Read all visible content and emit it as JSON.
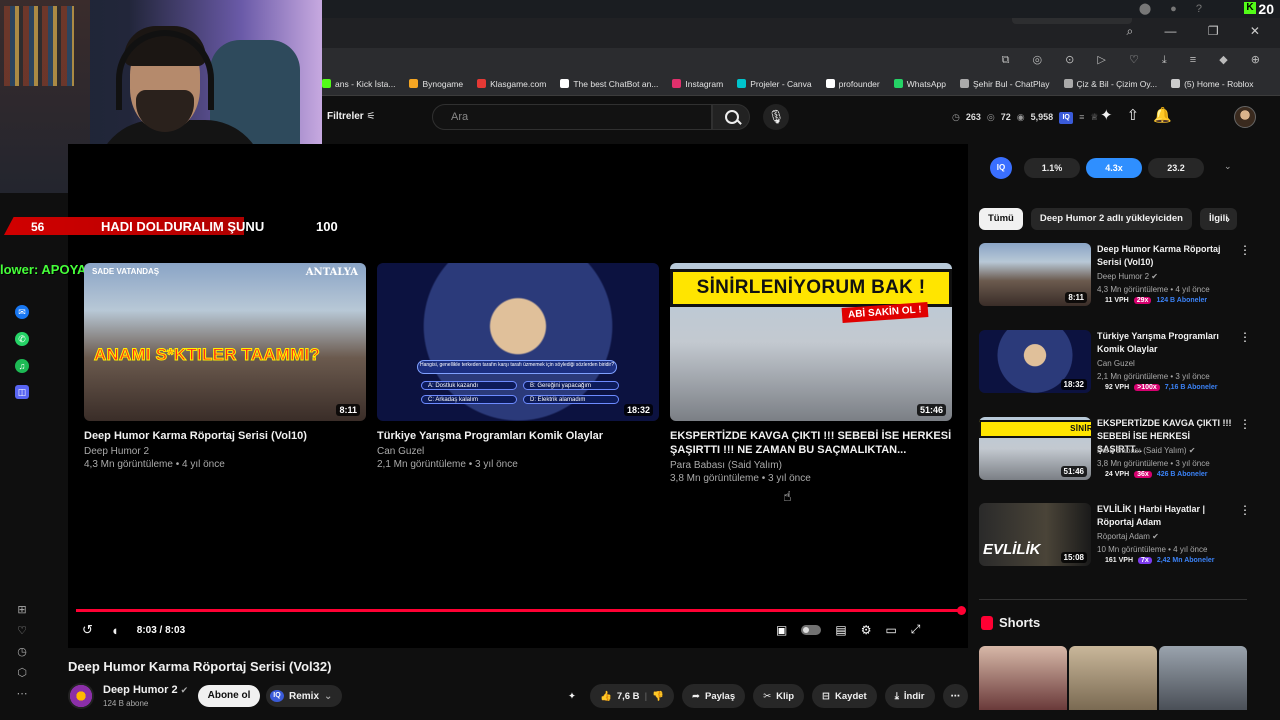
{
  "system": {
    "counter": "20",
    "kick_letter": "K"
  },
  "bookmarks": [
    {
      "label": "ans - Kick İsta...",
      "color": "#53fc18"
    },
    {
      "label": "Bynogame",
      "color": "#f5a623"
    },
    {
      "label": "Klasgame.com",
      "color": "#e53935"
    },
    {
      "label": "The best ChatBot an...",
      "color": "#ffffff"
    },
    {
      "label": "Instagram",
      "color": "#e1306c"
    },
    {
      "label": "Projeler - Canva",
      "color": "#00c4cc"
    },
    {
      "label": "profounder",
      "color": "#ffffff"
    },
    {
      "label": "WhatsApp",
      "color": "#25d366"
    },
    {
      "label": "Şehir Bul - ChatPlay",
      "color": "#aaaaaa"
    },
    {
      "label": "Çiz & Bil - Çizim Oy...",
      "color": "#aaaaaa"
    },
    {
      "label": "(5) Home - Roblox",
      "color": "#cccccc"
    }
  ],
  "header": {
    "filters_label": "Filtreler",
    "search_placeholder": "Ara",
    "stats": [
      "263",
      "72",
      "5,958"
    ]
  },
  "overlay": {
    "progress_left": "56",
    "progress_label": "HADI DOLDURALIM ŞUNU",
    "progress_right": "100",
    "follower_text": "lower: APOYASIRTAKIOYNATIPSKEN"
  },
  "end_cards": [
    {
      "title": "Deep Humor Karma Röportaj Serisi (Vol10)",
      "channel": "Deep Humor 2",
      "meta": "4,3 Mn görüntüleme • 4 yıl önce",
      "duration": "8:11",
      "thumb_text": "ANAMI S*KTILER TAAMMI?",
      "thumb_corner": "ANTALYA",
      "thumb_corner_left": "SADE VATANDAŞ"
    },
    {
      "title": "Türkiye Yarışma Programları Komik Olaylar",
      "channel": "Can Guzel",
      "meta": "2,1 Mn görüntüleme • 3 yıl önce",
      "duration": "18:32",
      "thumb_question": "Hangisi, genellikle terkeden tarafın karşı tarafı üzmemek için söylediği sözlerden biridir?",
      "answers": [
        "A: Dostluk kazandı",
        "B: Gereğini yapacağım",
        "C: Arkadaş kalalım",
        "D: Elektrik alamadım"
      ]
    },
    {
      "title": "EKSPERTİZDE KAVGA ÇIKTI !!! SEBEBİ İSE HERKESİ ŞAŞIRTTI !!! NE ZAMAN BU SAÇMALIKTAN...",
      "channel": "Para Babası (Said Yalım)",
      "meta": "3,8 Mn görüntüleme • 3 yıl önce",
      "duration": "51:46",
      "thumb_banner": "SİNİRLENİYORUM BAK !",
      "thumb_sub": "ABİ SAKİN OL !"
    }
  ],
  "player": {
    "time": "8:03 / 8:03",
    "progress_fraction": 1.0
  },
  "video": {
    "title": "Deep Humor Karma Röportaj Serisi (Vol32)",
    "channel": "Deep Humor 2",
    "subs": "124 B abone",
    "subscribe_label": "Abone ol",
    "remix_label": "Remix",
    "likes": "7,6 B",
    "share_label": "Paylaş",
    "clip_label": "Klip",
    "save_label": "Kaydet",
    "download_label": "İndir"
  },
  "iq_panel": {
    "chips": [
      "1.1%",
      "4.3x",
      "23.2"
    ],
    "active_index": 1,
    "logo": "IQ"
  },
  "chips": [
    "Tümü",
    "Deep Humor 2 adlı yükleyiciden",
    "İlgili"
  ],
  "related": [
    {
      "title": "Deep Humor Karma Röportaj Serisi (Vol10)",
      "channel": "Deep Humor 2",
      "meta": "4,3 Mn görüntüleme • 4 yıl önce",
      "duration": "8:11",
      "vph": "11 VPH",
      "mult": "29x",
      "subs": "124 B Aboneler",
      "mult_color": "pink"
    },
    {
      "title": "Türkiye Yarışma Programları Komik Olaylar",
      "channel": "Can Guzel",
      "meta": "2,1 Mn görüntüleme • 3 yıl önce",
      "duration": "18:32",
      "vph": "92 VPH",
      "mult": ">100x",
      "subs": "7,16 B Aboneler",
      "mult_color": "pink"
    },
    {
      "title": "EKSPERTİZDE KAVGA ÇIKTI !!! SEBEBİ İSE HERKESİ ŞAŞIRTT...",
      "channel": "Para Babası (Said Yalım)",
      "meta": "3,8 Mn görüntüleme • 3 yıl önce",
      "duration": "51:46",
      "vph": "24 VPH",
      "mult": "36x",
      "subs": "426 B Aboneler",
      "mult_color": "pink"
    },
    {
      "title": "EVLİLİK | Harbi Hayatlar | Röportaj Adam",
      "channel": "Röportaj Adam",
      "meta": "10 Mn görüntüleme • 4 yıl önce",
      "duration": "15:08",
      "vph": "161 VPH",
      "mult": "7x",
      "subs": "2,42 Mn Aboneler",
      "mult_color": "purple",
      "thumb_text": "EVLİLİK"
    }
  ],
  "shorts": {
    "title": "Shorts"
  }
}
